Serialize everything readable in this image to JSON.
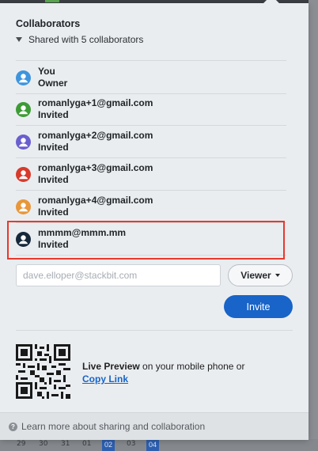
{
  "panel": {
    "title": "Collaborators",
    "shared_summary": "Shared with 5 collaborators"
  },
  "collaborators": [
    {
      "email": "You",
      "role": "Owner",
      "color": "#3e95dd"
    },
    {
      "email": "romanlyga+1@gmail.com",
      "role": "Invited",
      "color": "#3d9b36"
    },
    {
      "email": "romanlyga+2@gmail.com",
      "role": "Invited",
      "color": "#6a5fcf"
    },
    {
      "email": "romanlyga+3@gmail.com",
      "role": "Invited",
      "color": "#d83a2c"
    },
    {
      "email": "romanlyga+4@gmail.com",
      "role": "Invited",
      "color": "#e8973a"
    },
    {
      "email": "mmmm@mmm.mm",
      "role": "Invited",
      "color": "#16283a"
    }
  ],
  "invite": {
    "email_placeholder": "dave.elloper@stackbit.com",
    "permission_selected": "Viewer",
    "invite_label": "Invite"
  },
  "live_preview": {
    "bold_text": "Live Preview",
    "text": " on your mobile phone or",
    "copy_link_label": "Copy Link"
  },
  "footer": {
    "help_text": "Learn more about sharing and collaboration"
  },
  "background_calendar": {
    "days": [
      "29",
      "30",
      "31",
      "01",
      "02",
      "03",
      "04"
    ]
  },
  "colors": {
    "accent": "#1864c8",
    "highlight": "#e8392c"
  }
}
